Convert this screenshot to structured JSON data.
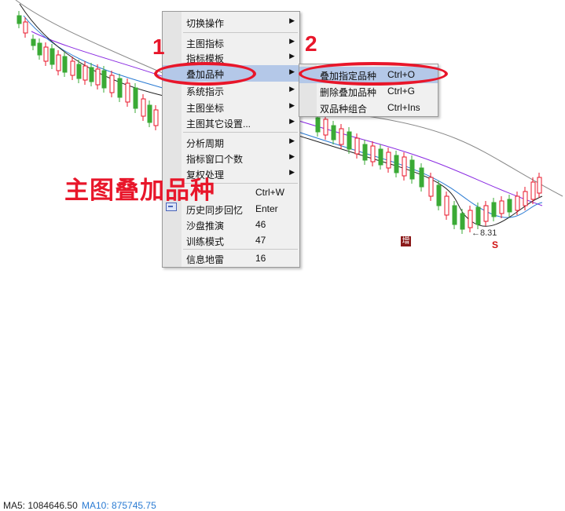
{
  "status": {
    "ma5": "MA5: 1084646.50",
    "ma10": "MA10: 875745.75"
  },
  "menu": {
    "items": [
      {
        "label": "切换操作",
        "shortcut": "",
        "submenu": true
      },
      {
        "label": "主图指标",
        "shortcut": "",
        "submenu": true
      },
      {
        "label": "指标模板",
        "shortcut": "",
        "submenu": true
      },
      {
        "label": "叠加品种",
        "shortcut": "",
        "submenu": true,
        "highlighted": true
      },
      {
        "label": "系统指示",
        "shortcut": "",
        "submenu": true
      },
      {
        "label": "主图坐标",
        "shortcut": "",
        "submenu": true
      },
      {
        "label": "主图其它设置...",
        "shortcut": "",
        "submenu": true
      },
      {
        "label": "分析周期",
        "shortcut": "",
        "submenu": true
      },
      {
        "label": "指标窗口个数",
        "shortcut": "",
        "submenu": true
      },
      {
        "label": "复权处理",
        "shortcut": "",
        "submenu": true
      },
      {
        "label": "",
        "shortcut": "Ctrl+W",
        "submenu": false
      },
      {
        "label": "历史同步回忆",
        "shortcut": "Enter",
        "submenu": false
      },
      {
        "label": "沙盘推演",
        "shortcut": "46",
        "submenu": false
      },
      {
        "label": "训练模式",
        "shortcut": "47",
        "submenu": false
      },
      {
        "label": "信息地雷",
        "shortcut": "16",
        "submenu": false
      }
    ],
    "arrow_glyph": "▶"
  },
  "submenu": {
    "items": [
      {
        "label": "叠加指定品种",
        "shortcut": "Ctrl+O",
        "highlighted": true
      },
      {
        "label": "删除叠加品种",
        "shortcut": "Ctrl+G"
      },
      {
        "label": "双品种组合",
        "shortcut": "Ctrl+Ins"
      }
    ]
  },
  "annotations": {
    "step1": "1",
    "step2": "2",
    "caption": "主图叠加品种",
    "highlight_color": "#e8162a"
  },
  "chart": {
    "low_price_label": "←8.31",
    "mark_zeng": "增",
    "mark_s": "S"
  },
  "colors": {
    "up_candle": "#e8162a",
    "down_candle": "#3aaa35",
    "ma_blue": "#2a7bd3",
    "ma_purple": "#8a2be2",
    "ma_gray": "#888888"
  }
}
